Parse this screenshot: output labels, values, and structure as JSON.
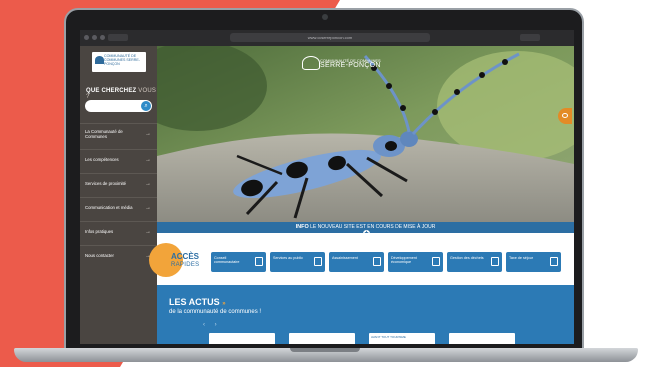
{
  "browser": {
    "url": "www.ccserreponcon.com",
    "tab_hint": "Communauté de communes de Serre-Ponçon"
  },
  "sidebar": {
    "logo": "COMMUNAUTÉ DE COMMUNES SERRE-PONÇON",
    "search_title_bold": "QUE CHERCHEZ",
    "search_title_rest": "VOUS ?",
    "search_placeholder": "",
    "items": [
      {
        "label": "La Communauté de Communes"
      },
      {
        "label": "Les compétences"
      },
      {
        "label": "Services de proximité"
      },
      {
        "label": "Communication et média"
      },
      {
        "label": "Infos pratiques"
      },
      {
        "label": "Nous contacter"
      }
    ]
  },
  "hero": {
    "logo_small": "COMMUNAUTÉ DE COMMUNES",
    "logo_big": "SERRE-PONÇON"
  },
  "info_bar": {
    "bold": "INFO",
    "text": "LE NOUVEAU SITE EST EN COURS DE MISE À JOUR"
  },
  "acces": {
    "title": "ACCÈS",
    "subtitle": "RAPIDES",
    "tiles": [
      {
        "label": "Conseil communautaire",
        "icon": "meeting-icon"
      },
      {
        "label": "Services au public",
        "icon": "bus-icon"
      },
      {
        "label": "Assainissement",
        "icon": "water-icon"
      },
      {
        "label": "Développement économique",
        "icon": "building-icon"
      },
      {
        "label": "Gestion des déchets",
        "icon": "trash-icon"
      },
      {
        "label": "Taxe de séjour",
        "icon": "sign-icon"
      }
    ]
  },
  "actus": {
    "title": "LES ACTUS",
    "title_suffix": "»",
    "subtitle": "de la communauté de communes !",
    "nav": "‹ ›",
    "cards": [
      {
        "label": ""
      },
      {
        "label": ""
      },
      {
        "label": "AVANT TOUT TOURISME"
      },
      {
        "label": ""
      }
    ]
  },
  "colors": {
    "background_accent": "#ec5b4b",
    "brand_blue": "#2c7ab5",
    "accent_orange": "#f2a43a",
    "sidebar": "#4a4541"
  }
}
